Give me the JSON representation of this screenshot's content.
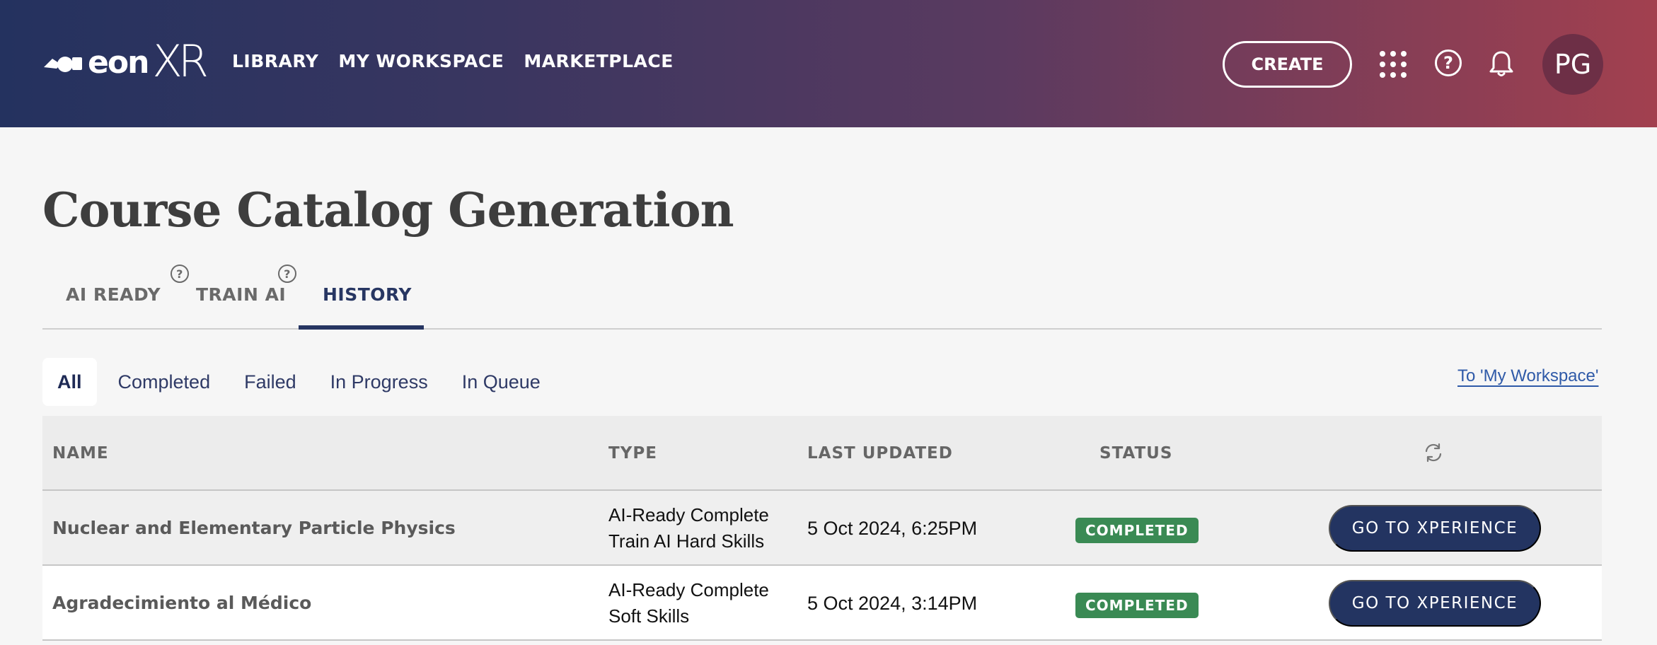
{
  "header": {
    "logo_text": "eonXR",
    "nav": [
      "LIBRARY",
      "MY WORKSPACE",
      "MARKETPLACE"
    ],
    "create_label": "CREATE",
    "avatar_initials": "PG",
    "icons": [
      "apps-grid-icon",
      "help-icon",
      "bell-icon"
    ]
  },
  "page": {
    "title": "Course Catalog Generation"
  },
  "tabs": [
    {
      "label": "AI READY",
      "has_help": true
    },
    {
      "label": "TRAIN AI",
      "has_help": true
    },
    {
      "label": "HISTORY",
      "active": true
    }
  ],
  "filters": {
    "items": [
      "All",
      "Completed",
      "Failed",
      "In Progress",
      "In Queue"
    ],
    "active": "All",
    "workspace_link": "To 'My Workspace'"
  },
  "table": {
    "columns": [
      "NAME",
      "TYPE",
      "LAST UPDATED",
      "STATUS"
    ],
    "rows": [
      {
        "name": "Nuclear and Elementary Particle Physics",
        "type_line1": "AI-Ready Complete",
        "type_line2": "Train AI Hard Skills",
        "updated": "5 Oct 2024, 6:25PM",
        "status": "COMPLETED",
        "action": "GO TO XPERIENCE"
      },
      {
        "name": "Agradecimiento al Médico",
        "type_line1": "AI-Ready Complete",
        "type_line2": "Soft Skills",
        "updated": "5 Oct 2024, 3:14PM",
        "status": "COMPLETED",
        "action": "GO TO XPERIENCE"
      }
    ]
  },
  "colors": {
    "brand_navy": "#233461",
    "status_green": "#3a8a54",
    "link_blue": "#2f5aa8",
    "header_gradient_start": "#24325f",
    "header_gradient_end": "#a2404f"
  }
}
